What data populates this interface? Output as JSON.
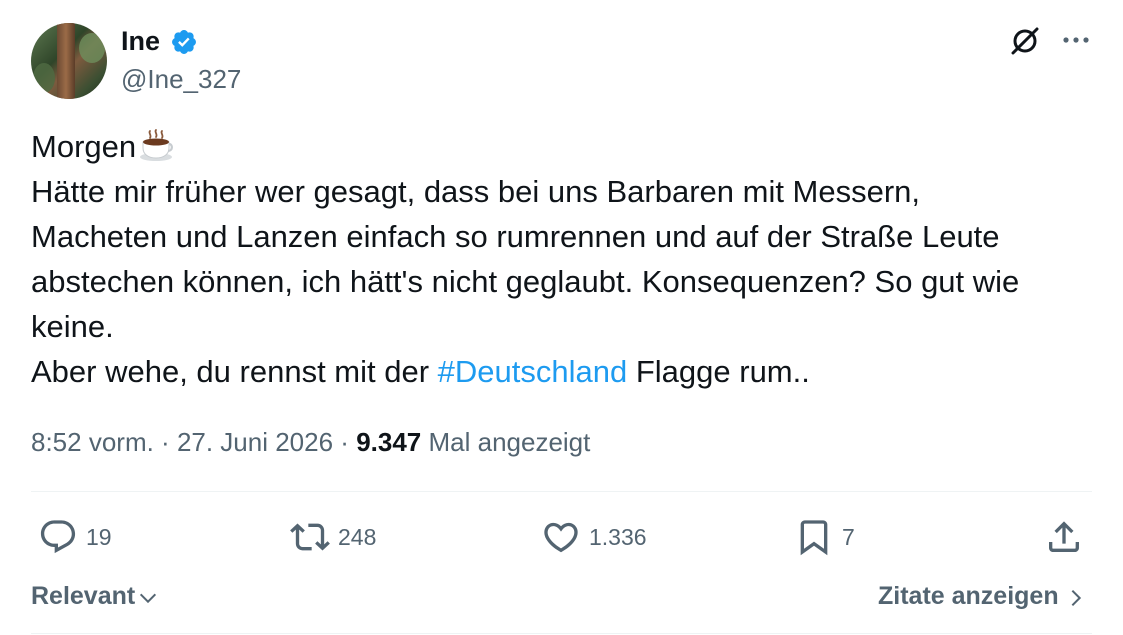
{
  "author": {
    "name": "Ine",
    "handle": "@Ine_327",
    "verified": true,
    "verified_color": "#1d9bf0"
  },
  "tweet": {
    "line1": "Morgen",
    "line1_emoji": "hot-beverage-emoji",
    "line2": "Hätte mir früher wer gesagt, dass bei uns Barbaren mit Messern,",
    "line3": "Macheten und Lanzen einfach so rumrennen und auf der Straße Leute",
    "line4": "abstechen können, ich hätt's nicht geglaubt. Konsequenzen? So gut wie",
    "line5": "keine.",
    "line6_before": "Aber wehe, du rennst mit der ",
    "line6_hashtag": "#Deutschland",
    "line6_after": " Flagge rum.."
  },
  "meta": {
    "time": "8:52 vorm.",
    "separator1": " · ",
    "date": "27. Juni 2026",
    "separator2": " · ",
    "views_count": "9.347",
    "views_label": " Mal angezeigt"
  },
  "actions": {
    "replies": "19",
    "reposts": "248",
    "likes": "1.336",
    "bookmarks": "7"
  },
  "footer": {
    "sort_label": "Relevant",
    "quotes_label": "Zitate anzeigen"
  },
  "colors": {
    "text": "#0f1419",
    "secondary": "#536471",
    "link": "#1d9bf0",
    "divider": "#eff3f4"
  },
  "icons": [
    "verified-badge-icon",
    "grok-icon",
    "more-icon",
    "reply-icon",
    "repost-icon",
    "like-icon",
    "bookmark-icon",
    "share-icon",
    "chevron-down-icon",
    "chevron-right-icon"
  ]
}
